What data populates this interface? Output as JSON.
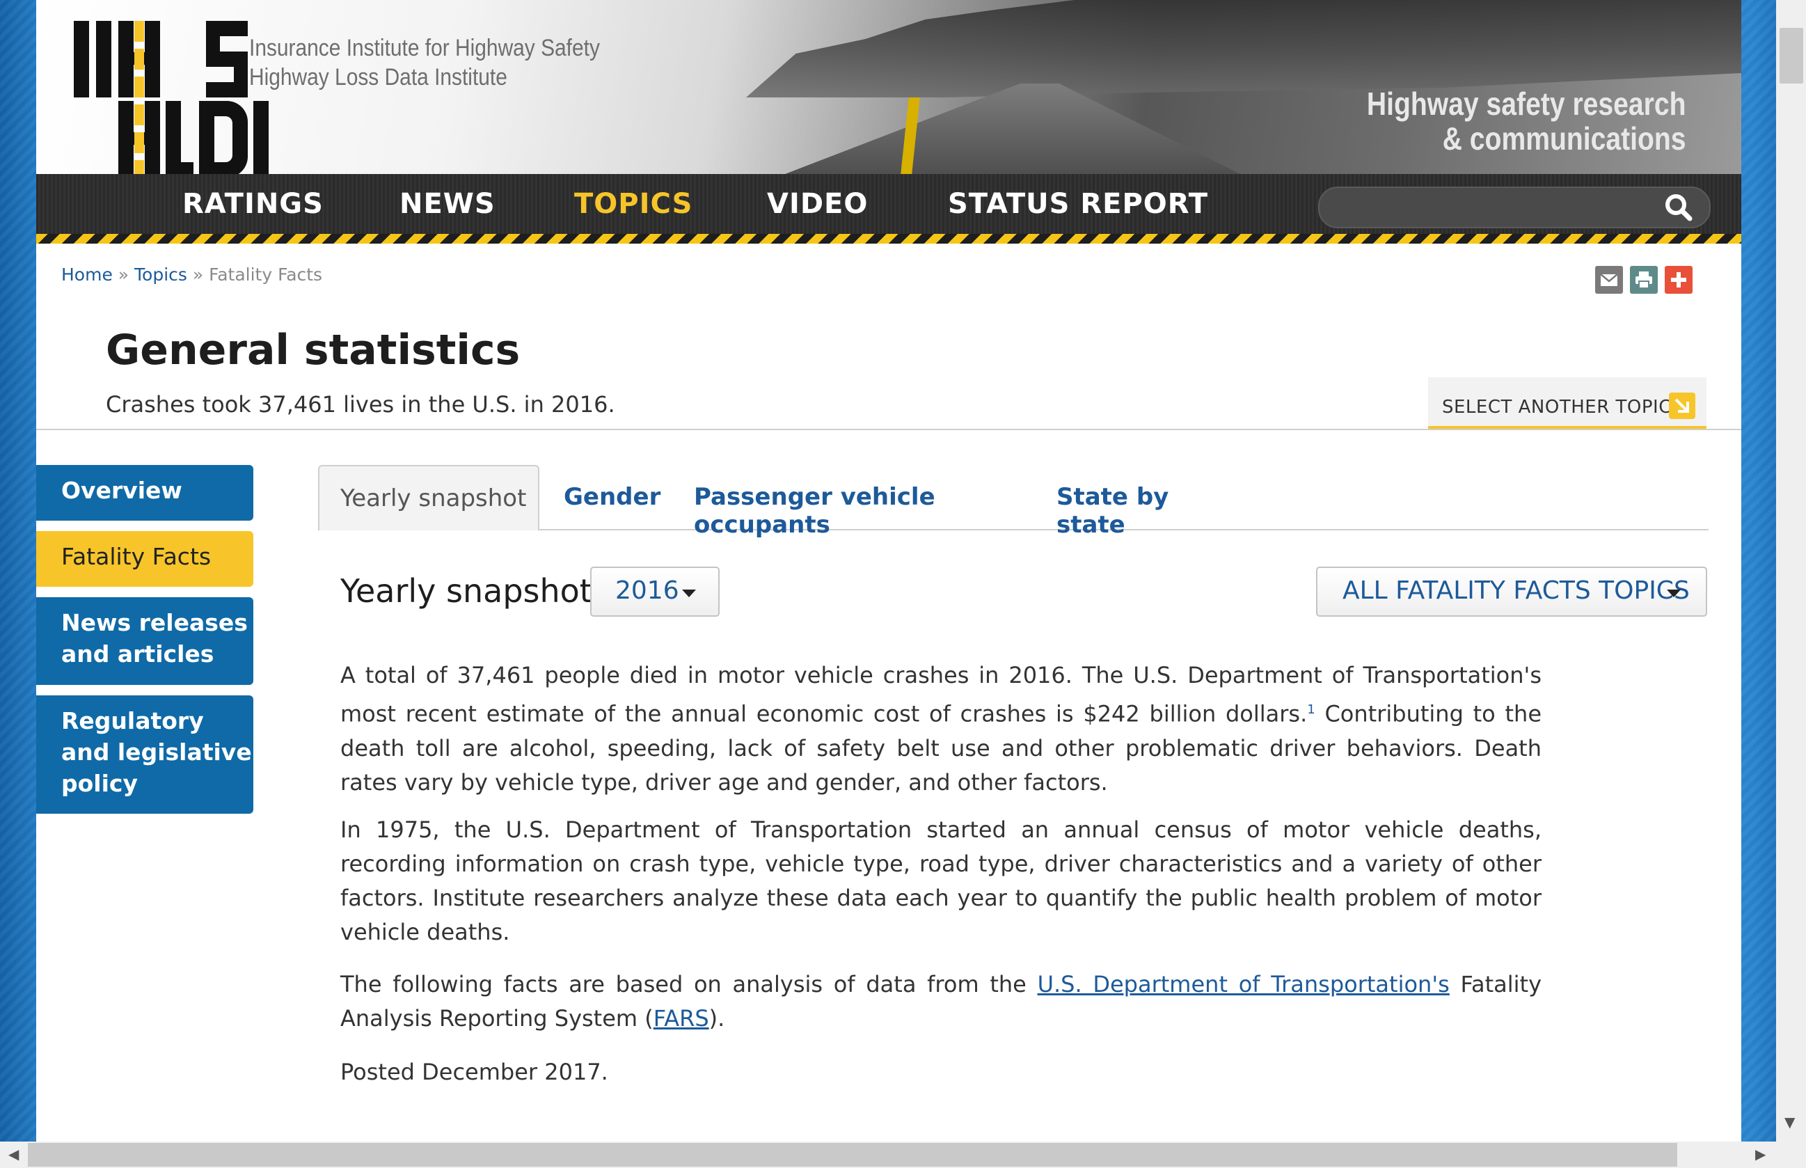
{
  "header": {
    "logo_text_line1": "Insurance Institute for Highway Safety",
    "logo_text_line2": "Highway Loss Data Institute",
    "tagline_line1": "Highway safety research",
    "tagline_line2": "& communications"
  },
  "nav": {
    "items": [
      "RATINGS",
      "NEWS",
      "TOPICS",
      "VIDEO",
      "STATUS REPORT"
    ],
    "active": "TOPICS",
    "search_placeholder": ""
  },
  "breadcrumb": {
    "home": "Home",
    "sep": "»",
    "topics": "Topics",
    "current": "Fatality Facts"
  },
  "page": {
    "title": "General statistics",
    "subtitle": "Crashes took 37,461 lives in the U.S. in 2016.",
    "select_topic": "SELECT ANOTHER TOPIC"
  },
  "sidebar": {
    "items": [
      {
        "label": "Overview"
      },
      {
        "label": "Fatality Facts"
      },
      {
        "label_line1": "News releases",
        "label_line2": "and articles"
      },
      {
        "label_line1": "Regulatory",
        "label_line2": "and legislative",
        "label_line3": "policy"
      }
    ]
  },
  "tabs": [
    "Yearly snapshot",
    "Gender",
    "Passenger vehicle occupants",
    "State by state"
  ],
  "content": {
    "section_title": "Yearly snapshot",
    "year": "2016",
    "all_topics": "ALL FATALITY FACTS TOPICS",
    "p1a": "A total of 37,461 people died in motor vehicle crashes in 2016. The U.S. Department of Transportation's most recent estimate of the annual economic cost of crashes is $242 billion dollars.",
    "p1_sup": "1",
    "p1b": " Contributing to the death toll are alcohol, speeding, lack of safety belt use and other problematic driver behaviors. Death rates vary by vehicle type, driver age and gender, and other factors.",
    "p2": "In 1975, the U.S. Department of Transportation started an annual census of motor vehicle deaths, recording information on crash type, vehicle type, road type, driver characteristics and a variety of other factors. Institute researchers analyze these data each year to quantify the public health problem of motor vehicle deaths.",
    "p3a": "The following facts are based on analysis of data from the ",
    "p3_link": "U.S. Department of Transportation's",
    "p3b": " Fatality Analysis Reporting System (",
    "p3_link2": "FARS",
    "p3c": ").",
    "p4": "Posted December 2017."
  },
  "colors": {
    "accent_yellow": "#f7c52a",
    "nav_blue": "#0f6aa7",
    "link_blue": "#1d5a9a"
  }
}
